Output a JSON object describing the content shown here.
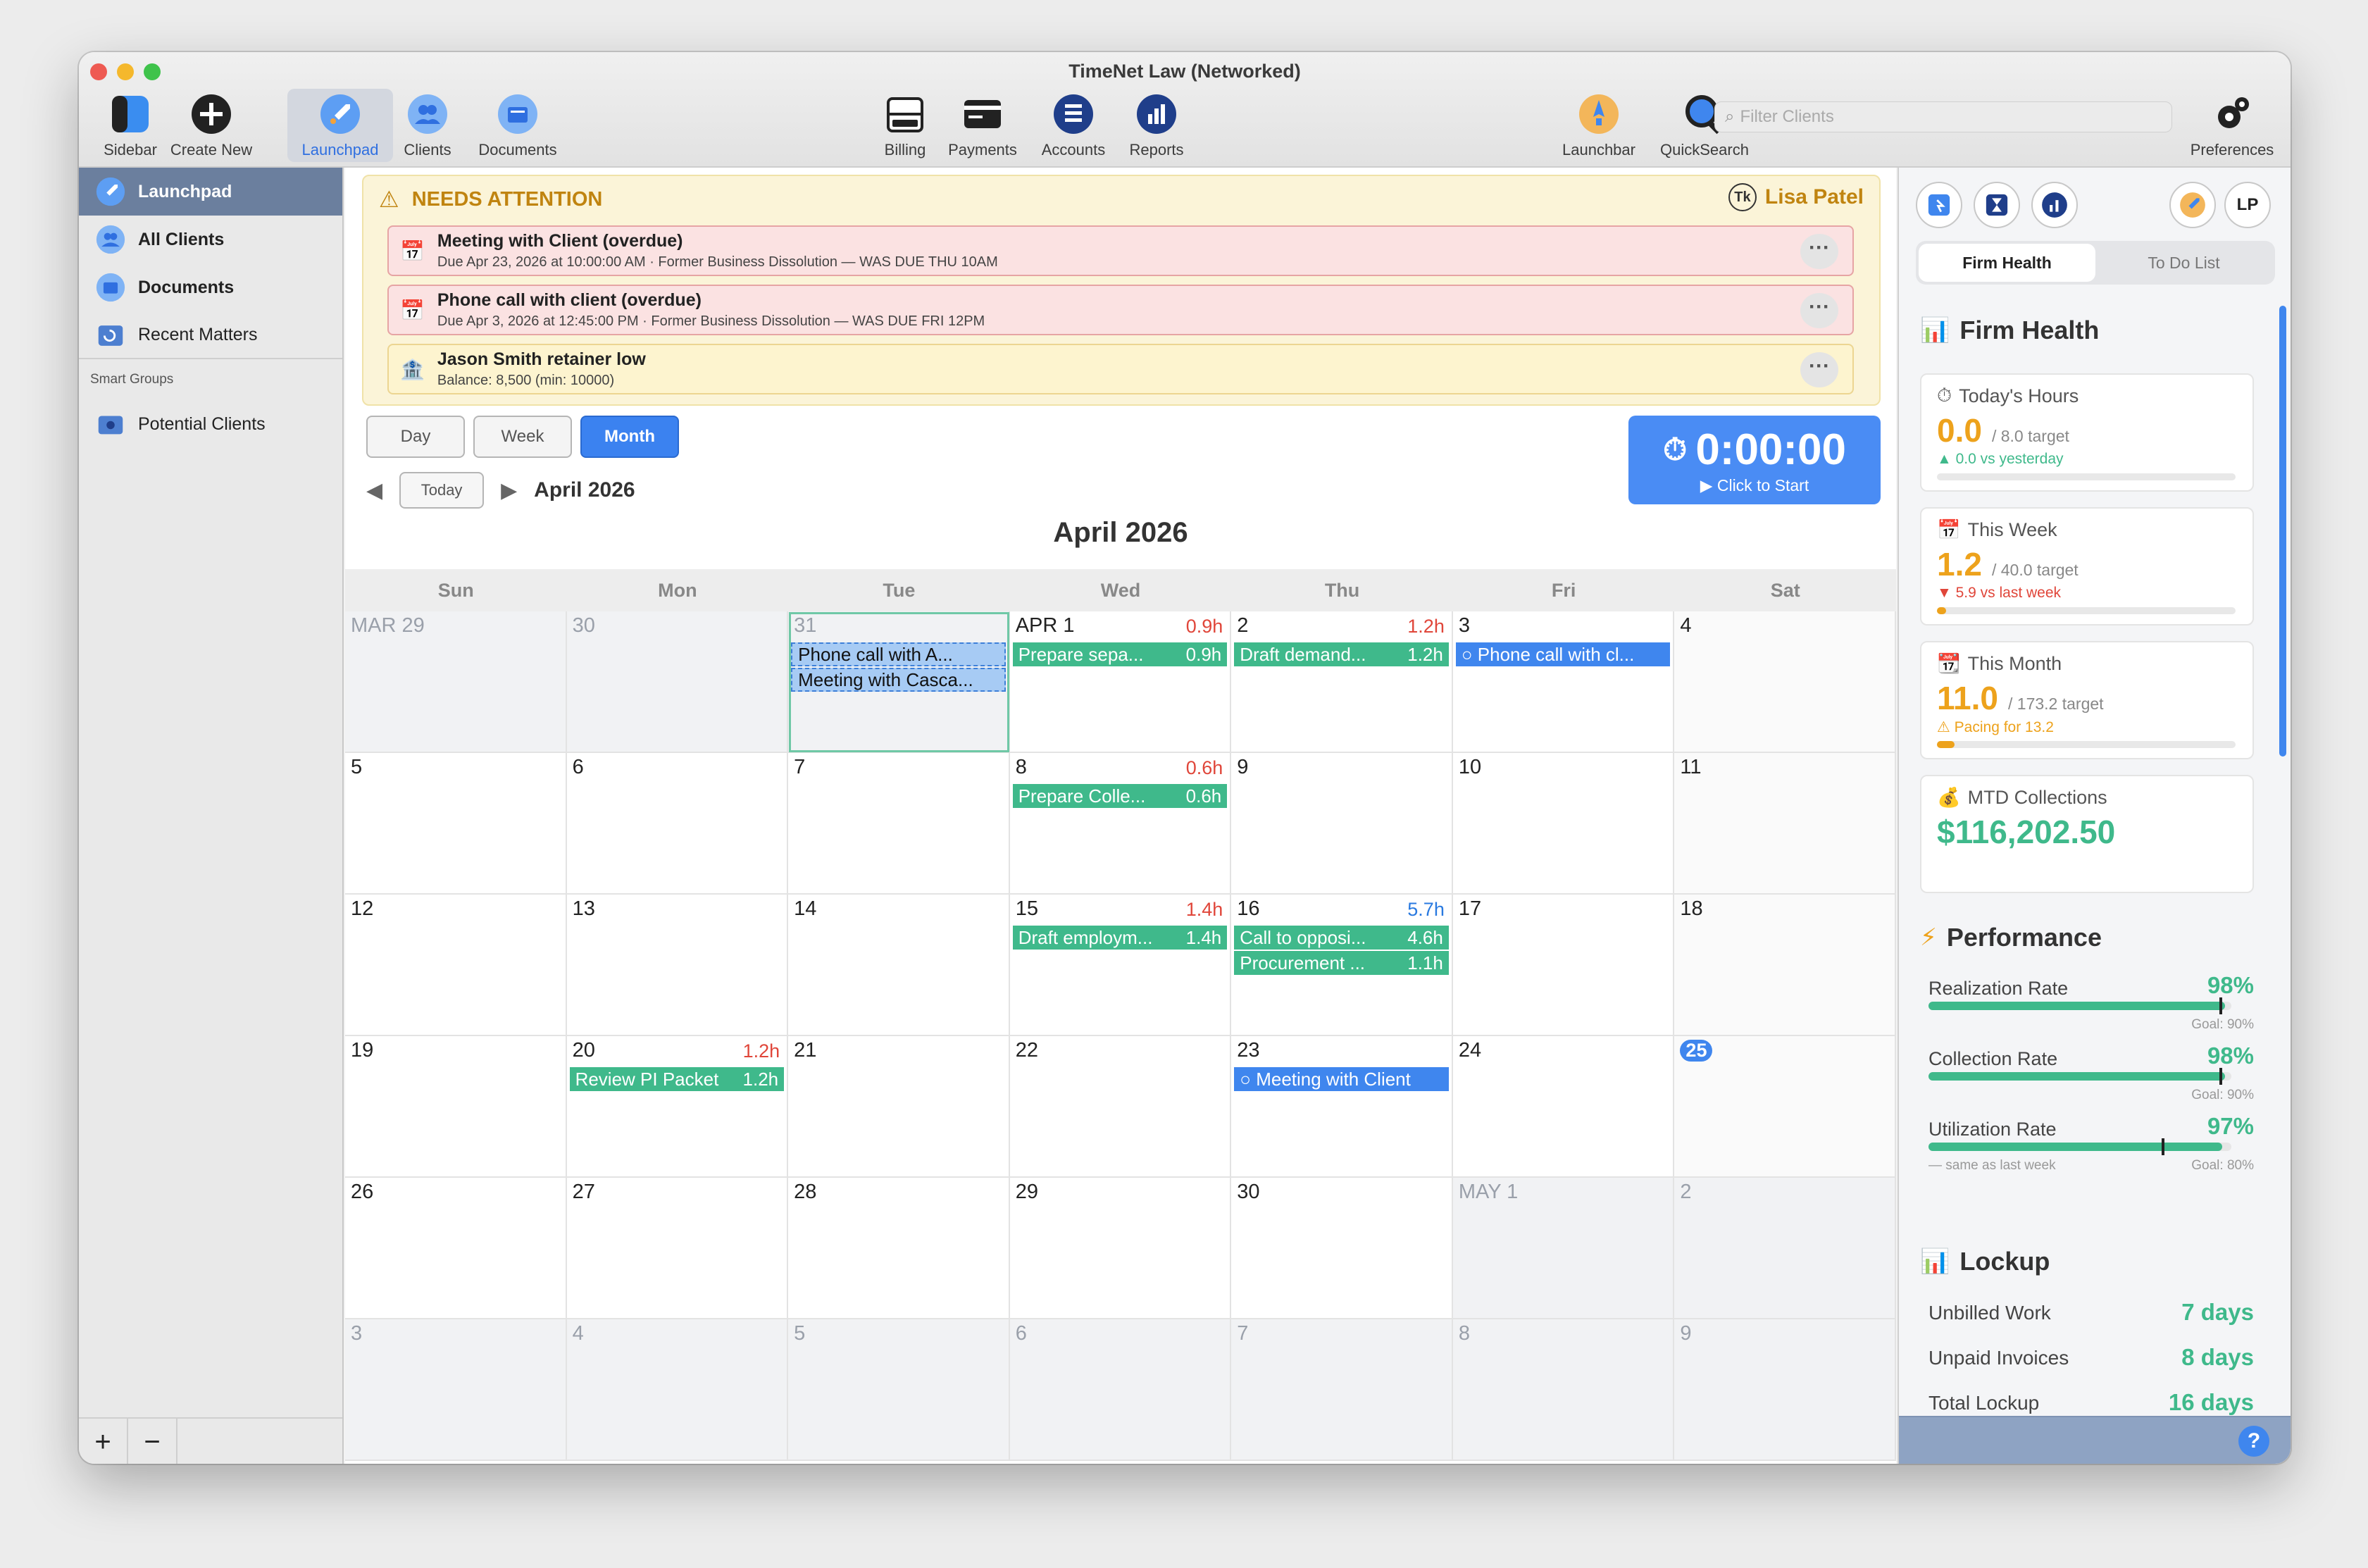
{
  "window": {
    "title": "TimeNet Law (Networked)"
  },
  "toolbar": {
    "sidebar": "Sidebar",
    "create_new": "Create New",
    "launchpad": "Launchpad",
    "clients": "Clients",
    "documents": "Documents",
    "billing": "Billing",
    "payments": "Payments",
    "accounts": "Accounts",
    "reports": "Reports",
    "launchbar": "Launchbar",
    "quicksearch": "QuickSearch",
    "preferences": "Preferences",
    "search_placeholder": "Filter Clients"
  },
  "sidebar": {
    "items": [
      {
        "label": "Launchpad"
      },
      {
        "label": "All Clients"
      },
      {
        "label": "Documents"
      },
      {
        "label": "Recent Matters"
      }
    ],
    "section": "Smart Groups",
    "groups": [
      {
        "label": "Potential Clients"
      }
    ],
    "add": "+",
    "remove": "−"
  },
  "attention": {
    "title": "NEEDS ATTENTION",
    "user": "Lisa Patel",
    "items": [
      {
        "title": "Meeting with Client (overdue)",
        "sub": "Due Apr 23, 2026 at 10:00:00 AM · Former Business Dissolution — WAS DUE THU 10AM",
        "more": "···"
      },
      {
        "title": "Phone call with client (overdue)",
        "sub": "Due Apr 3, 2026 at 12:45:00 PM · Former Business Dissolution — WAS DUE FRI 12PM",
        "more": "···"
      },
      {
        "title": "Jason Smith retainer low",
        "sub": "Balance: 8,500 (min: 10000)",
        "more": "···"
      }
    ]
  },
  "view": {
    "day": "Day",
    "week": "Week",
    "month": "Month",
    "today": "Today",
    "period": "April 2026",
    "prev": "◀",
    "next": "▶"
  },
  "timer": {
    "value": "0:00:00",
    "sub": "▶ Click to Start"
  },
  "calendar": {
    "title": "April 2026",
    "days": [
      "Sun",
      "Mon",
      "Tue",
      "Wed",
      "Thu",
      "Fri",
      "Sat"
    ],
    "weeks": [
      [
        {
          "d": "MAR 29",
          "out": true
        },
        {
          "d": "30",
          "out": true
        },
        {
          "d": "31",
          "out": true,
          "events": [
            {
              "t": "Phone call with A...",
              "c": "sel"
            },
            {
              "t": "Meeting with Casca...",
              "c": "sel"
            }
          ]
        },
        {
          "d": "APR 1",
          "hrs": "0.9h",
          "events": [
            {
              "t": "Prepare sepa...",
              "h": "0.9h",
              "c": "g"
            }
          ]
        },
        {
          "d": "2",
          "hrs": "1.2h",
          "events": [
            {
              "t": "Draft demand...",
              "h": "1.2h",
              "c": "g"
            }
          ]
        },
        {
          "d": "3",
          "events": [
            {
              "t": "○ Phone call with cl...",
              "c": "b"
            }
          ]
        },
        {
          "d": "4",
          "wk": true
        }
      ],
      [
        {
          "d": "5"
        },
        {
          "d": "6"
        },
        {
          "d": "7"
        },
        {
          "d": "8",
          "hrs": "0.6h",
          "events": [
            {
              "t": "Prepare Colle...",
              "h": "0.6h",
              "c": "g"
            }
          ]
        },
        {
          "d": "9"
        },
        {
          "d": "10"
        },
        {
          "d": "11",
          "wk": true
        }
      ],
      [
        {
          "d": "12"
        },
        {
          "d": "13"
        },
        {
          "d": "14"
        },
        {
          "d": "15",
          "hrs": "1.4h",
          "events": [
            {
              "t": "Draft employm...",
              "h": "1.4h",
              "c": "g"
            }
          ]
        },
        {
          "d": "16",
          "hrs": "5.7h",
          "hblue": true,
          "events": [
            {
              "t": "Call to opposi...",
              "h": "4.6h",
              "c": "g"
            },
            {
              "t": "Procurement ...",
              "h": "1.1h",
              "c": "g"
            }
          ]
        },
        {
          "d": "17"
        },
        {
          "d": "18",
          "wk": true
        }
      ],
      [
        {
          "d": "19"
        },
        {
          "d": "20",
          "hrs": "1.2h",
          "events": [
            {
              "t": "Review PI Packet",
              "h": "1.2h",
              "c": "g"
            }
          ]
        },
        {
          "d": "21"
        },
        {
          "d": "22"
        },
        {
          "d": "23",
          "events": [
            {
              "t": "○ Meeting with Client",
              "c": "b"
            }
          ]
        },
        {
          "d": "24"
        },
        {
          "d": "25",
          "today": true,
          "wk": true
        }
      ],
      [
        {
          "d": "26"
        },
        {
          "d": "27"
        },
        {
          "d": "28"
        },
        {
          "d": "29"
        },
        {
          "d": "30"
        },
        {
          "d": "MAY 1",
          "out": true
        },
        {
          "d": "2",
          "out": true
        }
      ],
      [
        {
          "d": "3",
          "out": true
        },
        {
          "d": "4",
          "out": true
        },
        {
          "d": "5",
          "out": true
        },
        {
          "d": "6",
          "out": true
        },
        {
          "d": "7",
          "out": true
        },
        {
          "d": "8",
          "out": true
        },
        {
          "d": "9",
          "out": true
        }
      ]
    ]
  },
  "right_panel": {
    "avatar": "LP",
    "tabs": [
      "Firm Health",
      "To Do List"
    ],
    "firm_health": {
      "title": "Firm Health",
      "cards": [
        {
          "label": "Today's Hours",
          "value": "0.0",
          "target": "/ 8.0 target",
          "note": "▲ 0.0 vs yesterday",
          "note_color": "#3fb98b",
          "progress": 0
        },
        {
          "label": "This Week",
          "value": "1.2",
          "target": "/ 40.0 target",
          "note": "▼ 5.9 vs last week",
          "note_color": "#e0463a",
          "progress": 0.03
        },
        {
          "label": "This Month",
          "value": "11.0",
          "target": "/ 173.2 target",
          "note": "⚠ Pacing for 13.2",
          "note_color": "#eda21c",
          "progress": 0.06
        }
      ],
      "collections": {
        "label": "MTD Collections",
        "value": "$116,202.50"
      }
    },
    "performance": {
      "title": "Performance",
      "rates": [
        {
          "label": "Realization Rate",
          "value": "98%",
          "goal": "Goal: 90%",
          "note": "",
          "fill": 0.98,
          "mark": 0.96
        },
        {
          "label": "Collection Rate",
          "value": "98%",
          "goal": "Goal: 90%",
          "note": "",
          "fill": 0.98,
          "mark": 0.96
        },
        {
          "label": "Utilization Rate",
          "value": "97%",
          "goal": "Goal: 80%",
          "note": "— same as last week",
          "fill": 0.97,
          "mark": 0.77
        }
      ]
    },
    "lockup": {
      "title": "Lockup",
      "rows": [
        {
          "label": "Unbilled Work",
          "value": "7 days"
        },
        {
          "label": "Unpaid Invoices",
          "value": "8 days"
        },
        {
          "label": "Total Lockup",
          "value": "16 days"
        }
      ]
    },
    "help": "?"
  }
}
